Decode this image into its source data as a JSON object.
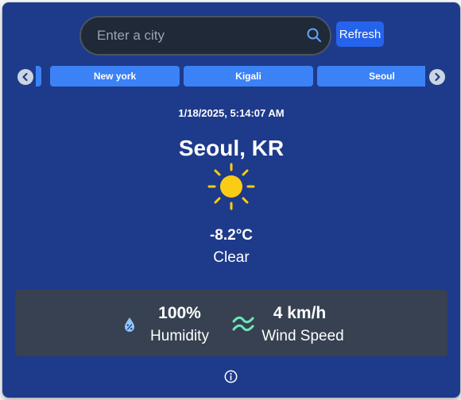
{
  "search": {
    "placeholder": "Enter a city",
    "value": ""
  },
  "toolbar": {
    "refresh_label": "Refresh"
  },
  "cities": [
    "",
    "New york",
    "Kigali",
    "Seoul"
  ],
  "weather": {
    "datetime": "1/18/2025, 5:14:07 AM",
    "city": "Seoul, KR",
    "temperature": "-8.2°C",
    "condition": "Clear",
    "icon": "sun-icon"
  },
  "stats": {
    "humidity_value": "100%",
    "humidity_label": "Humidity",
    "wind_value": "4 km/h",
    "wind_label": "Wind Speed"
  },
  "colors": {
    "card_bg": "#1e3a8a",
    "accent": "#2563eb",
    "tab": "#3b82f6",
    "sun": "#facc15",
    "panel": "#374151"
  },
  "icons": [
    "search-icon",
    "chevron-left-icon",
    "chevron-right-icon",
    "sun-icon",
    "humidity-icon",
    "wind-icon",
    "info-icon"
  ]
}
